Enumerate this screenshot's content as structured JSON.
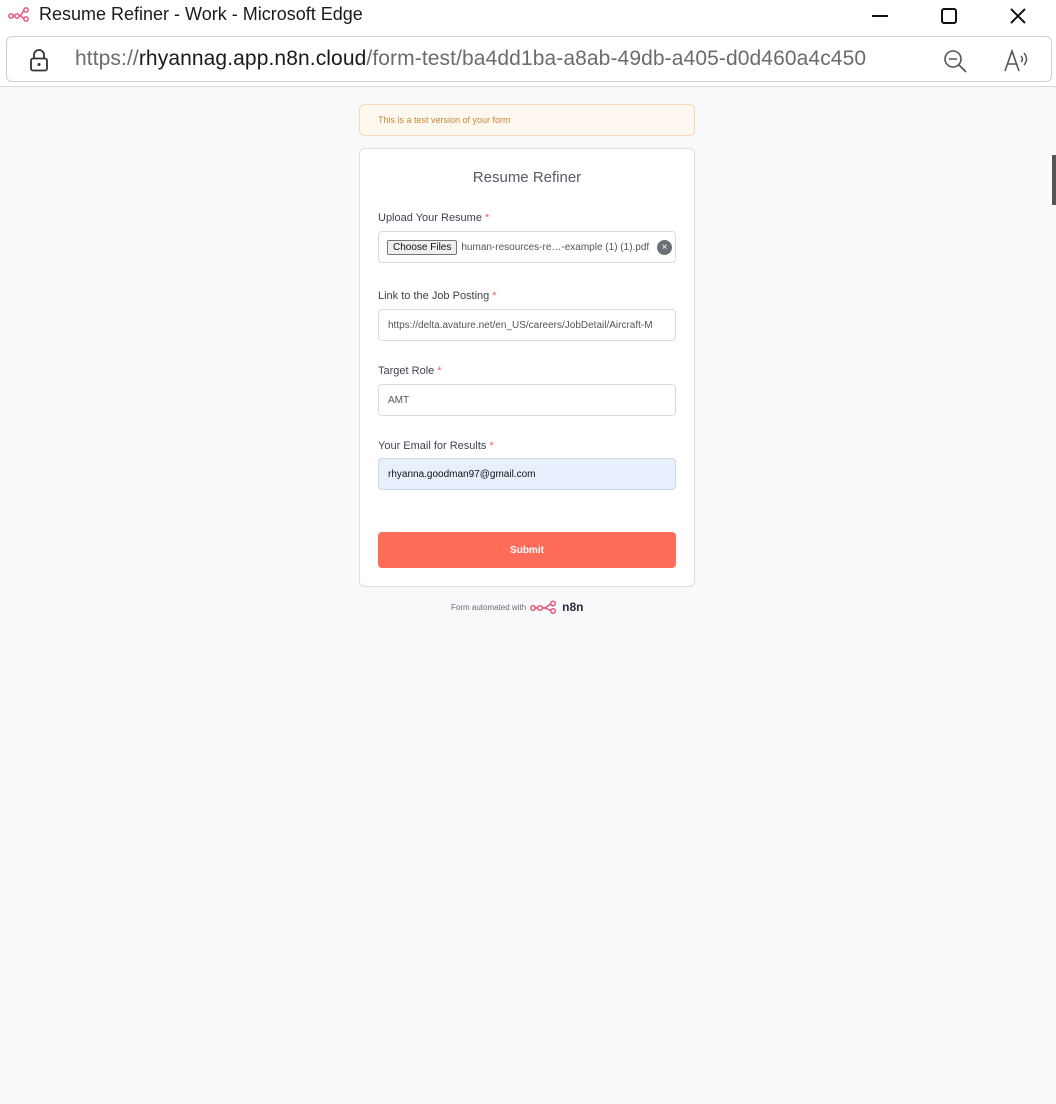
{
  "window": {
    "title": "Resume Refiner - Work - Microsoft Edge"
  },
  "addressbar": {
    "url_scheme": "https://",
    "url_host": "rhyannag.app.n8n.cloud",
    "url_path": "/form-test/ba4dd1ba-a8ab-49db-a405-d0d460a4c450"
  },
  "form": {
    "test_banner": "This is a test version of your form",
    "title": "Resume Refiner",
    "fields": [
      {
        "label": "Upload Your Resume",
        "required_mark": "*",
        "button_label": "Choose Files",
        "value": "human-resources-re…-example (1) (1).pdf"
      },
      {
        "label": "Link to the Job Posting",
        "required_mark": "*",
        "value": "https://delta.avature.net/en_US/careers/JobDetail/Aircraft-M"
      },
      {
        "label": "Target Role",
        "required_mark": "*",
        "value": "AMT"
      },
      {
        "label": "Your Email for Results",
        "required_mark": "*",
        "value": "rhyanna.goodman97@gmail.com"
      }
    ],
    "submit_label": "Submit",
    "footer_text": "Form automated with",
    "footer_brand": "n8n"
  },
  "colors": {
    "accent": "#ff6d5a",
    "required": "#ff5d5d",
    "banner_text": "#c9862f",
    "autofill_bg": "#e8f0fe"
  },
  "icons": [
    "n8n-logo-icon",
    "minimize-icon",
    "maximize-icon",
    "close-icon",
    "lock-icon",
    "zoom-out-icon",
    "read-aloud-icon",
    "clear-file-icon"
  ]
}
